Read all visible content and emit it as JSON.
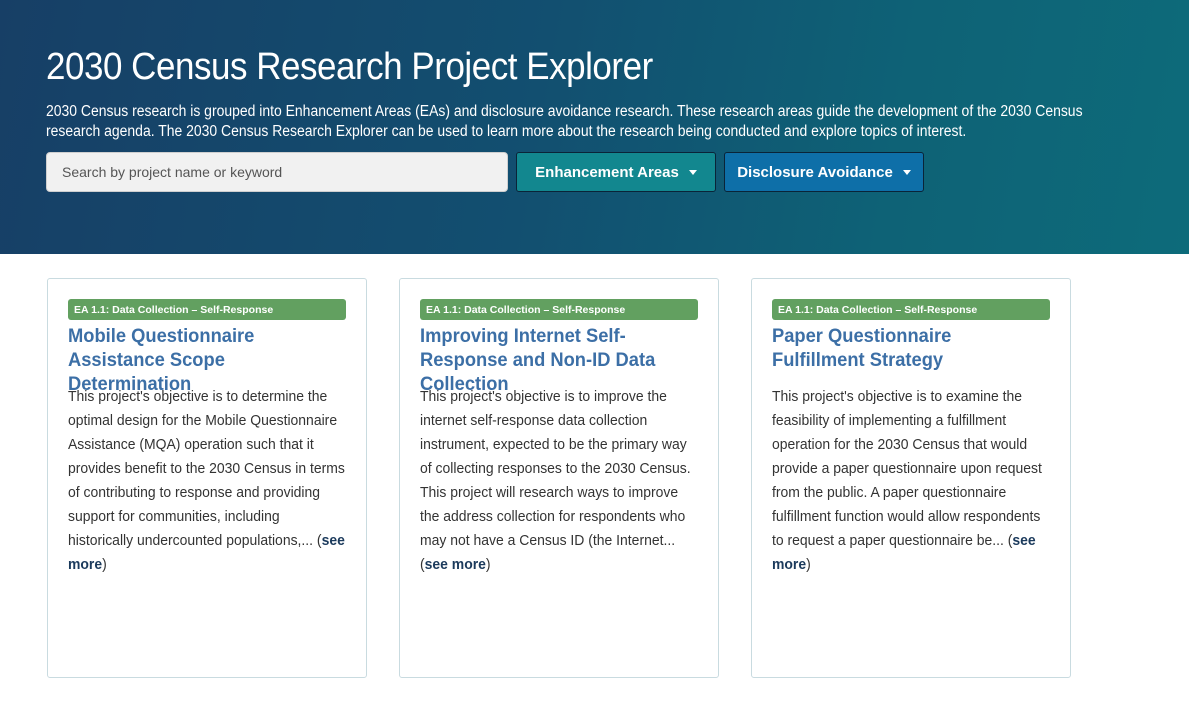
{
  "header": {
    "title": "2030 Census Research Project Explorer",
    "description": "2030 Census research is grouped into Enhancement Areas (EAs) and disclosure avoidance research. These research areas guide the development of the 2030 Census research agenda. The 2030 Census Research Explorer can be used to learn more about the research being conducted and explore topics of interest."
  },
  "search": {
    "placeholder": "Search by project name or keyword"
  },
  "buttons": {
    "enhancement_areas": "Enhancement Areas",
    "disclosure_avoidance": "Disclosure Avoidance"
  },
  "colors": {
    "header_gradient_start": "#173f66",
    "header_gradient_end": "#0d6b7a",
    "enhancement_button": "#12878f",
    "disclosure_button": "#0e6fa8",
    "tag": "#62a060",
    "card_title": "#3c6fa6"
  },
  "cards": [
    {
      "tag": "EA 1.1: Data Collection – Self-Response",
      "title": "Mobile Questionnaire Assistance Scope Determination",
      "excerpt": "This project's objective is to determine the optimal design for the Mobile Questionnaire Assistance (MQA) operation such that it provides benefit to the 2030 Census in terms of contributing to response and providing support for communities, including historically undercounted populations,...",
      "open_paren": " (",
      "see_more": "see more",
      "close_paren": ")"
    },
    {
      "tag": "EA 1.1: Data Collection – Self-Response",
      "title": "Improving Internet Self-Response and Non-ID Data Collection",
      "excerpt": "This project's objective is to improve the internet self-response data collection instrument, expected to be the primary way of collecting responses to the 2030 Census. This project will research ways to improve the address collection for respondents who may not have a Census ID (the Internet...",
      "open_paren": " (",
      "see_more": "see more",
      "close_paren": ")"
    },
    {
      "tag": "EA 1.1: Data Collection – Self-Response",
      "title": "Paper Questionnaire Fulfillment Strategy",
      "excerpt": "This project's objective is to examine the feasibility of implementing a fulfillment operation for the 2030 Census that would provide a paper questionnaire upon request from the public. A paper questionnaire fulfillment function would allow respondents to request a paper questionnaire be...",
      "open_paren": " (",
      "see_more": "see more",
      "close_paren": ")"
    }
  ]
}
